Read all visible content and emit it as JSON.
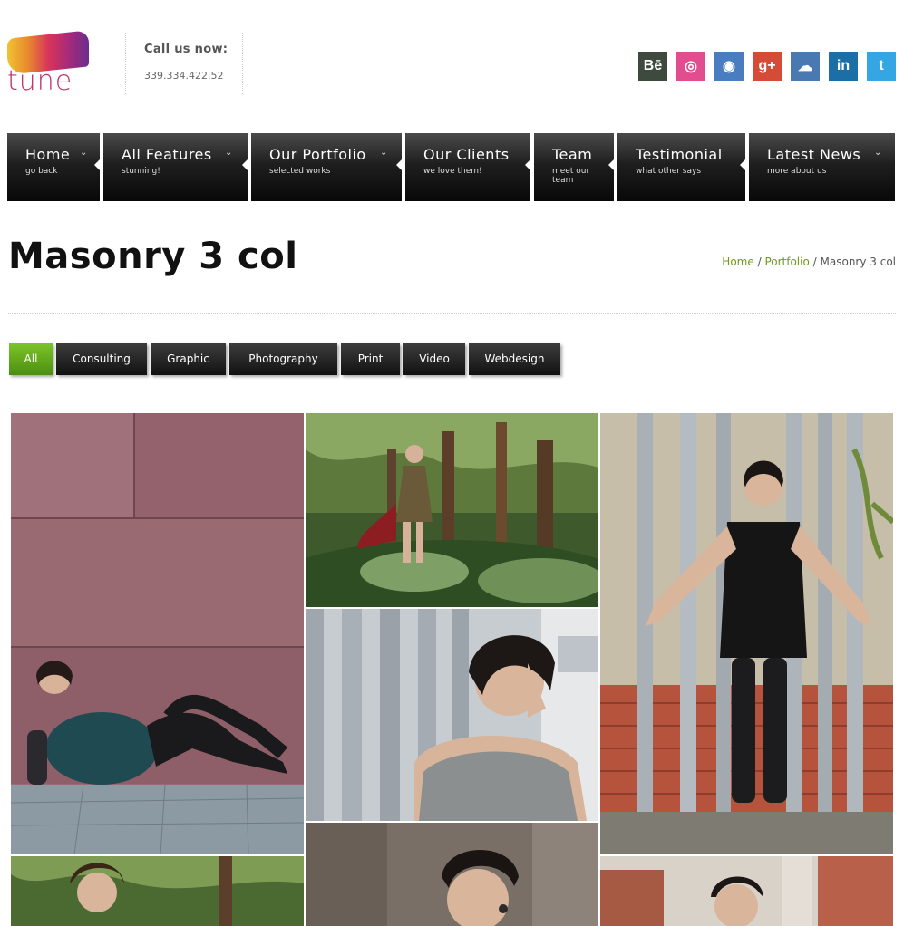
{
  "brand": {
    "logo_text": "tune"
  },
  "contact": {
    "title": "Call us now:",
    "phone": "339.334.422.52"
  },
  "social": [
    {
      "name": "behance",
      "glyph": "Bē",
      "color": "#3e4a3e"
    },
    {
      "name": "dribbble",
      "glyph": "◎",
      "color": "#e24d8f"
    },
    {
      "name": "github",
      "glyph": "◉",
      "color": "#4a7dbf"
    },
    {
      "name": "google-plus",
      "glyph": "g+",
      "color": "#d44b37"
    },
    {
      "name": "cloud",
      "glyph": "☁",
      "color": "#4a79b1"
    },
    {
      "name": "linkedin",
      "glyph": "in",
      "color": "#1c6ea6"
    },
    {
      "name": "twitter",
      "glyph": "t",
      "color": "#33a6e3"
    }
  ],
  "nav": [
    {
      "title": "Home",
      "sub": "go back"
    },
    {
      "title": "All Features",
      "sub": "stunning!"
    },
    {
      "title": "Our Portfolio",
      "sub": "selected works"
    },
    {
      "title": "Our Clients",
      "sub": "we love them!"
    },
    {
      "title": "Team",
      "sub": "meet our team"
    },
    {
      "title": "Testimonial",
      "sub": "what other says"
    },
    {
      "title": "Latest News",
      "sub": "more about us"
    }
  ],
  "page": {
    "title": "Masonry 3 col"
  },
  "breadcrumb": {
    "home": "Home",
    "sep1": "/",
    "portfolio": "Portfolio",
    "sep2": "/",
    "current": "Masonry 3 col"
  },
  "filters": [
    "All",
    "Consulting",
    "Graphic",
    "Photography",
    "Print",
    "Video",
    "Webdesign"
  ],
  "filter_active": "All",
  "colors": {
    "accent_green": "#6d9b18",
    "nav_dark": "#111111"
  }
}
